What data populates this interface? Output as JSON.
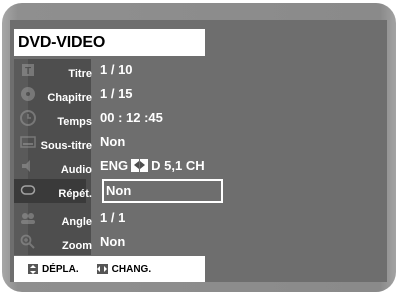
{
  "header": {
    "title": "DVD-VIDEO"
  },
  "menu": {
    "items": [
      {
        "label": "Titre",
        "value": "1 / 10",
        "icon": "title-icon"
      },
      {
        "label": "Chapitre",
        "value": "1 / 15",
        "icon": "chapter-icon"
      },
      {
        "label": "Temps",
        "value": "00 : 12 :45",
        "icon": "time-icon"
      },
      {
        "label": "Sous-titre",
        "value": "Non",
        "icon": "subtitle-icon"
      },
      {
        "label": "Audio",
        "value_lang": "ENG",
        "value_format": "D 5,1 CH",
        "icon": "audio-icon"
      },
      {
        "label": "Répét.",
        "value": "Non",
        "icon": "repeat-icon",
        "selected": true
      },
      {
        "label": "Angle",
        "value": "1 / 1",
        "icon": "angle-icon"
      },
      {
        "label": "Zoom",
        "value": "Non",
        "icon": "zoom-icon"
      }
    ]
  },
  "footer": {
    "move_label": "DÉPLA.",
    "change_label": "CHANG."
  },
  "colors": {
    "frame": "#8f8f8f",
    "screen": "#6e6e6e",
    "label_column": "#4e4e4e",
    "text": "#ffffff"
  }
}
